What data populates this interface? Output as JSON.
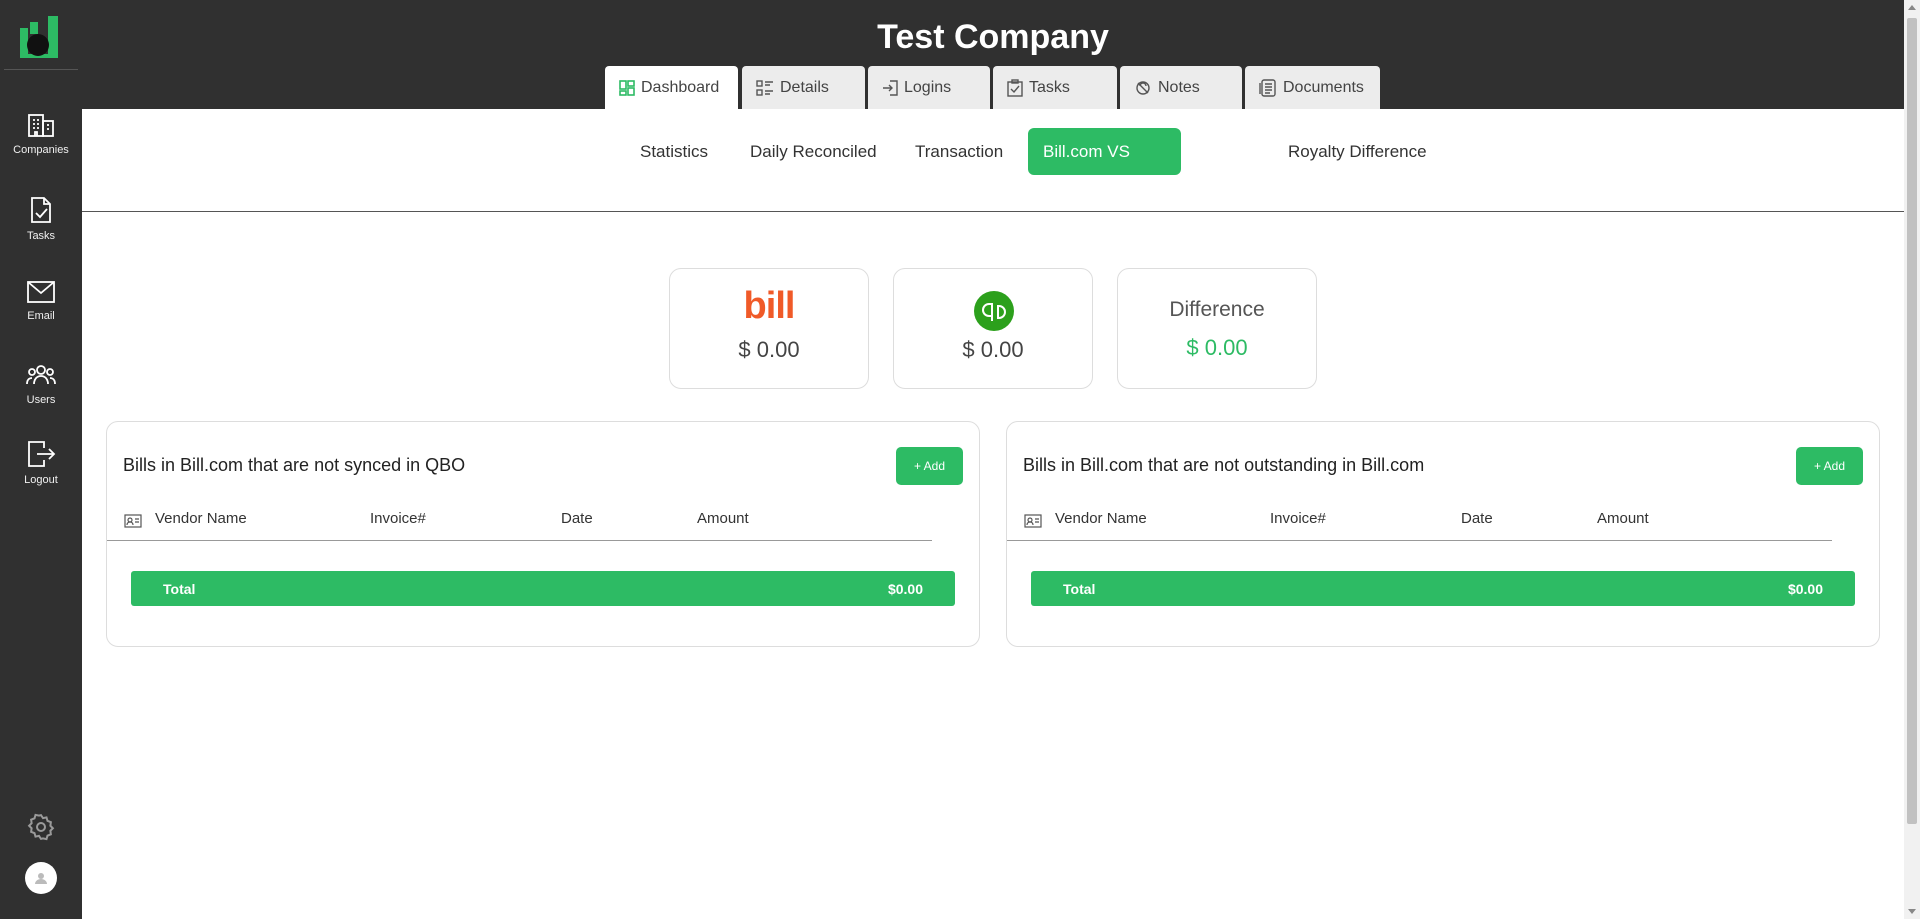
{
  "app": {
    "title": "Test Company"
  },
  "sidebar": {
    "items": [
      {
        "label": "Companies",
        "icon": "building-icon"
      },
      {
        "label": "Tasks",
        "icon": "clipboard-check-icon"
      },
      {
        "label": "Email",
        "icon": "envelope-icon"
      },
      {
        "label": "Users",
        "icon": "users-icon"
      },
      {
        "label": "Logout",
        "icon": "logout-icon"
      }
    ],
    "settings_icon": "gear-icon",
    "avatar_icon": "user-avatar-icon"
  },
  "tabs": [
    {
      "label": "Dashboard",
      "icon": "dashboard-icon",
      "active": true
    },
    {
      "label": "Details",
      "icon": "list-details-icon",
      "active": false
    },
    {
      "label": "Logins",
      "icon": "login-icon",
      "active": false
    },
    {
      "label": "Tasks",
      "icon": "clipboard-check-icon",
      "active": false
    },
    {
      "label": "Notes",
      "icon": "notes-icon",
      "active": false
    },
    {
      "label": "Documents",
      "icon": "documents-icon",
      "active": false
    }
  ],
  "subtabs": [
    {
      "label": "Statistics",
      "active": false
    },
    {
      "label": "Daily Reconciled",
      "active": false
    },
    {
      "label": "Transaction",
      "active": false
    },
    {
      "label": "Bill.com VS QBO",
      "active": true
    },
    {
      "label": "Royalty Difference",
      "active": false
    }
  ],
  "summary": {
    "bill": {
      "logo_text": "bill",
      "amount": "$ 0.00"
    },
    "qbo": {
      "logo_icon": "quickbooks-logo-icon",
      "amount": "$ 0.00"
    },
    "difference": {
      "title": "Difference",
      "amount": "$ 0.00"
    }
  },
  "panels": [
    {
      "title": "Bills in Bill.com that are not synced in QBO",
      "add_label": "+ Add",
      "columns": [
        "Vendor Name",
        "Invoice#",
        "Date",
        "Amount"
      ],
      "total_label": "Total",
      "total_value": "$0.00"
    },
    {
      "title": "Bills in Bill.com that are not outstanding in Bill.com",
      "add_label": "+ Add",
      "columns": [
        "Vendor Name",
        "Invoice#",
        "Date",
        "Amount"
      ],
      "total_label": "Total",
      "total_value": "$0.00"
    }
  ],
  "colors": {
    "accent": "#2dbb64",
    "sidebar_bg": "#303030",
    "bill_brand": "#f05a28",
    "qbo_brand": "#2ca01c"
  }
}
